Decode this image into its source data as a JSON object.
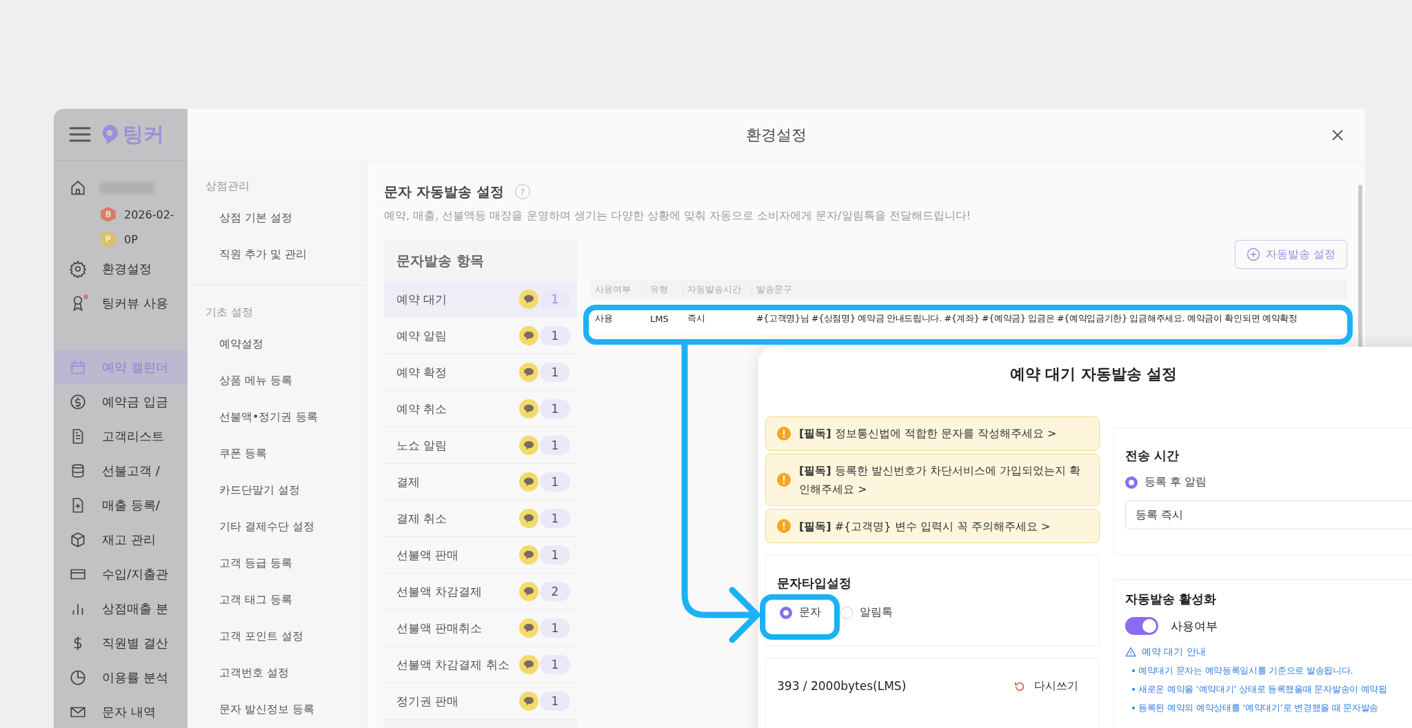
{
  "app": {
    "logo": "팅커",
    "store": {
      "grade_badge": "B",
      "date": "2026-02-",
      "points_badge": "P",
      "points": "0P"
    },
    "top_nav": [
      {
        "label": "환경설정",
        "alert": false
      },
      {
        "label": "팅커뷰 사용",
        "alert": true
      }
    ],
    "nav": [
      {
        "label": "예약 캘린더",
        "selected": true
      },
      {
        "label": "예약금 입금",
        "selected": false
      },
      {
        "label": "고객리스트",
        "selected": false
      },
      {
        "label": "선불고객 /",
        "selected": false
      },
      {
        "label": "매출 등록/",
        "selected": false
      },
      {
        "label": "재고 관리",
        "selected": false
      },
      {
        "label": "수입/지출관",
        "selected": false
      },
      {
        "label": "상점매출 분",
        "selected": false
      },
      {
        "label": "직원별 결산",
        "selected": false
      },
      {
        "label": "이용률 분석",
        "selected": false
      },
      {
        "label": "문자 내역",
        "selected": false
      }
    ]
  },
  "modal": {
    "title": "환경설정",
    "settings_nav": [
      {
        "heading": "상점관리",
        "items": [
          "상점 기본 설정",
          "직원 추가 및 관리"
        ]
      },
      {
        "heading": "기초 설정",
        "items": [
          "예약설정",
          "상품 메뉴 등록",
          "선불액•정기권 등록",
          "쿠폰 등록",
          "카드단말기 설정",
          "기타 결제수단 설정",
          "고객 등급 등록",
          "고객 태그 등록",
          "고객 포인트 설정",
          "고객번호 설정",
          "문자 발신정보 등록"
        ]
      }
    ],
    "section": {
      "title": "문자 자동발송 설정",
      "help_icon": "?",
      "description": "예약, 매출, 선불액등 매장을 운영하며 생기는 다양한 상황에 맞춰 자동으로 소비자에게 문자/알림톡을 전달해드립니다!",
      "items_heading": "문자발송 항목",
      "items": [
        {
          "label": "예약 대기",
          "count": "1",
          "selected": true
        },
        {
          "label": "예약 알림",
          "count": "1",
          "selected": false
        },
        {
          "label": "예약 확정",
          "count": "1",
          "selected": false
        },
        {
          "label": "예약 취소",
          "count": "1",
          "selected": false
        },
        {
          "label": "노쇼 알림",
          "count": "1",
          "selected": false
        },
        {
          "label": "결제",
          "count": "1",
          "selected": false
        },
        {
          "label": "결제 취소",
          "count": "1",
          "selected": false
        },
        {
          "label": "선불액 판매",
          "count": "1",
          "selected": false
        },
        {
          "label": "선불액 차감결제",
          "count": "2",
          "selected": false
        },
        {
          "label": "선불액 판매취소",
          "count": "1",
          "selected": false
        },
        {
          "label": "선불액 차감결제 취소",
          "count": "1",
          "selected": false
        },
        {
          "label": "정기권 판매",
          "count": "1",
          "selected": false
        }
      ],
      "add_button": "자동발송 설정",
      "table": {
        "columns": [
          "사용여부",
          "유형",
          "자동발송시간",
          "발송문구"
        ],
        "rows": [
          [
            "사용",
            "LMS",
            "즉시",
            "#{고객명}님 #{상점명} 예약금 안내드립니다. #{계좌} #{예약금} 입금은 #{예약입금기한} 입금해주세요. 예약금이 확인되면 예약확정"
          ]
        ]
      }
    }
  },
  "popup": {
    "title": "예약 대기 자동발송 설정",
    "notices": [
      "**[필독]** 정보통신법에 적합한 문자를 작성해주세요 >",
      "**[필독]** 등록한 발신번호가 차단서비스에 가입되었는지 확인해주세요 >",
      "**[필독]** #{고객명} 변수 입력시 꼭 주의해주세요 >"
    ],
    "text_type": {
      "title": "문자타입설정",
      "options": [
        {
          "label": "문자",
          "selected": true
        },
        {
          "label": "알림톡",
          "selected": false
        }
      ]
    },
    "bytes": "393 / 2000bytes(LMS)",
    "rewrite_button": "다시쓰기",
    "send_time": {
      "title": "전송 시간",
      "options": [
        {
          "label": "등록 후 알림",
          "selected": true
        }
      ],
      "value": "등록 즉시"
    },
    "activation": {
      "title": "자동발송 활성화",
      "toggle": {
        "label": "사용여부",
        "on": true
      },
      "guide_title": "예약 대기 안내",
      "guide_items": [
        "예약대기 문자는 예약등록일시를 기준으로 발송됩니다.",
        "새로운 예약을 ‘예약대기’ 상태로 등록했을때 문자발송이 예약됩",
        "등록된 예약의 예약상태를 ‘예약대기’로 변경했을 때 문자발송"
      ]
    }
  }
}
